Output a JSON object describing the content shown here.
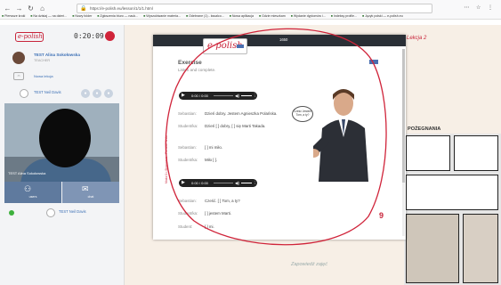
{
  "browser": {
    "url": "https://e-polish.eu/lesson/1/1/1.html",
    "bookmarks": [
      "Pierwsze kroki",
      "Na dzisiaj — na dzień...",
      "Nowy folder",
      "Zgłoszenia biuro — nauk...",
      "Wyszukiwanie materia...",
      "Odebrane (1) - kssalco...",
      "Nowa aplikacja",
      "Gdzie mieszkam",
      "Wydanie dyplomów i...",
      "Indeksy profile...",
      "Język polski — e-polish.eu"
    ]
  },
  "left_panel": {
    "logo": "e-polish",
    "timer": "0:20:09",
    "teacher": {
      "name": "TEST Alina Sokołowska",
      "role": "TEACHER"
    },
    "lesson_link": "Nowa lekcja",
    "student_name": "TEST Neil Davis",
    "video_label": "TEST Alina Sokołowska",
    "tabs": [
      {
        "label": "users",
        "icon": "users-icon"
      },
      {
        "label": "chat",
        "icon": "chat-icon"
      }
    ],
    "bottom_student": "TEST Neil Davis"
  },
  "modal": {
    "number": "1650",
    "logo": "e-polish",
    "title": "Exercise",
    "subtitle": "Listen and complete.",
    "sidebar_text": "Moduł 1 • Słownictwo • Pierwsze kroki",
    "player": {
      "time": "0:00 / 0:00"
    },
    "lines": [
      {
        "who": "Sebastian:",
        "text": "Dzień dobry. Jestem Agnieszka Polańska."
      },
      {
        "who": "Student/ka:",
        "text": "Dzień [ ] dobry, [ ] się Marti Takada."
      },
      {
        "who": "Sebastian:",
        "text": "[ ] mi miło."
      },
      {
        "who": "Student/ka:",
        "text": "Miło [ ]."
      }
    ],
    "lines2": [
      {
        "who": "Sebastian:",
        "text": "Cześć. [ ] Tom, a ty?"
      },
      {
        "who": "Student/ka:",
        "text": "[ ] jestem Marti."
      },
      {
        "who": "Student:",
        "text": "[ ] mi."
      }
    ],
    "bubble": "Cześć Jestem Tom, a ty?",
    "page_number": "9"
  },
  "page_right": {
    "heading": "Lekcja 2",
    "pozegnania": "POŻEGNANIA",
    "footer_text": "Zapowiedź zajęć"
  },
  "colors": {
    "brand_red": "#c8243a",
    "panel_blue": "#5f7a9e",
    "link_blue": "#3b6fb5"
  }
}
